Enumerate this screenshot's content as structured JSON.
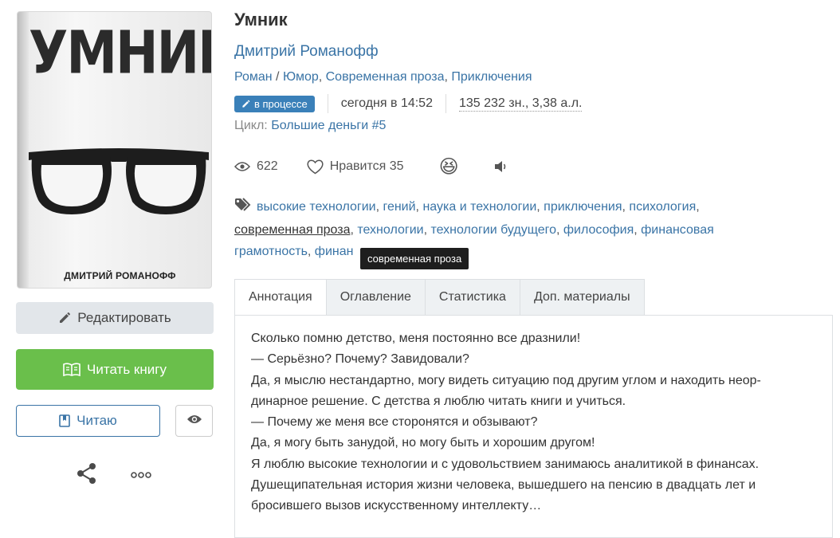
{
  "book": {
    "title": "Умник",
    "author": "Дмитрий Романофф",
    "genres": [
      "Роман",
      "Юмор",
      "Современная проза",
      "Приключения"
    ],
    "status": "в процессе",
    "updated": "сегодня в 14:52",
    "size": "135 232 зн., 3,38 а.л.",
    "cycle_label": "Цикл:",
    "cycle_name": "Большие деньги",
    "cycle_number": "#5"
  },
  "cover": {
    "title": "УМНИК",
    "author": "ДМИТРИЙ РОМАНОФФ"
  },
  "stats": {
    "views": "622",
    "likes_label": "Нравится",
    "likes": "35",
    "reaction_emoji": "😆"
  },
  "tags": [
    "высокие технологии",
    "гений",
    "наука и технологии",
    "приключения",
    "психология",
    "современная проза",
    "технологии",
    "технологии будущего",
    "философия",
    "финансовая грамотность",
    "финан"
  ],
  "tooltip": "современная проза",
  "buttons": {
    "edit": "Редактировать",
    "read": "Читать книгу",
    "reading": "Читаю"
  },
  "tabs": [
    "Аннотация",
    "Оглавление",
    "Статистика",
    "Доп. материалы"
  ],
  "annotation": [
    "Сколько помню детство, меня постоянно все дразнили!",
    "— Серьёзно? Почему? Завидовали?",
    "Да, я мыслю нестандартно, могу видеть ситуацию под другим углом и находить неор-",
    "динарное решение. С детства я люблю читать книги и учиться.",
    "— Почему же меня все сторонятся и обзывают?",
    "Да, я могу быть занудой, но могу быть и хорошим другом!",
    "Я люблю высокие технологии и с удовольствием занимаюсь аналитикой в финансах.",
    "Душещипательная история жизни человека, вышедшего на пенсию в двадцать лет и",
    "бросившего вызов искусственному интеллекту…"
  ],
  "colors": {
    "link": "#3a74a6",
    "status_badge": "#3a80b9",
    "read_button": "#6abf4b",
    "edit_button": "#e2e6ea"
  }
}
